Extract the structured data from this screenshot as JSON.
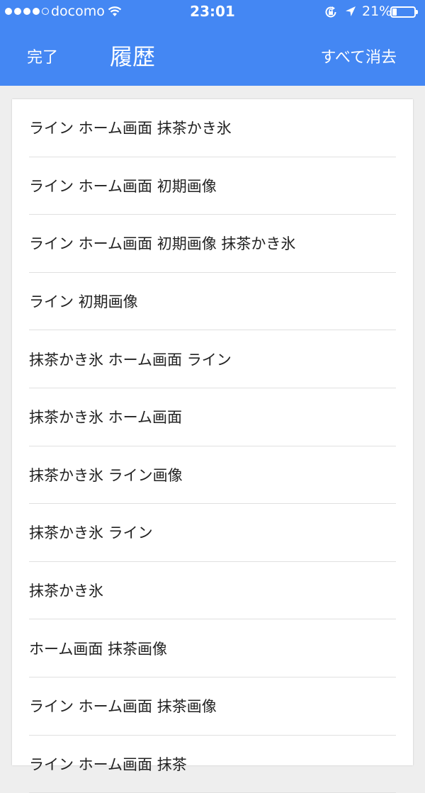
{
  "status_bar": {
    "carrier": "docomo",
    "time": "23:01",
    "battery_percent_text": "21%",
    "battery_level": 0.21,
    "signal_strength": 4,
    "signal_max": 5,
    "icons": [
      "signal-dots",
      "wifi-icon",
      "rotation-lock-icon",
      "location-arrow-icon",
      "battery-icon"
    ]
  },
  "header": {
    "done_label": "完了",
    "title": "履歴",
    "clear_all_label": "すべて消去",
    "background_color": "#4487f3",
    "text_color": "#ffffff"
  },
  "history": {
    "items": [
      "ライン ホーム画面 抹茶かき氷",
      "ライン ホーム画面 初期画像",
      "ライン ホーム画面 初期画像 抹茶かき氷",
      "ライン 初期画像",
      "抹茶かき氷 ホーム画面 ライン",
      "抹茶かき氷 ホーム画面",
      "抹茶かき氷 ライン画像",
      "抹茶かき氷 ライン",
      "抹茶かき氷",
      "ホーム画面 抹茶画像",
      "ライン ホーム画面 抹茶画像",
      "ライン ホーム画面 抹茶"
    ]
  }
}
